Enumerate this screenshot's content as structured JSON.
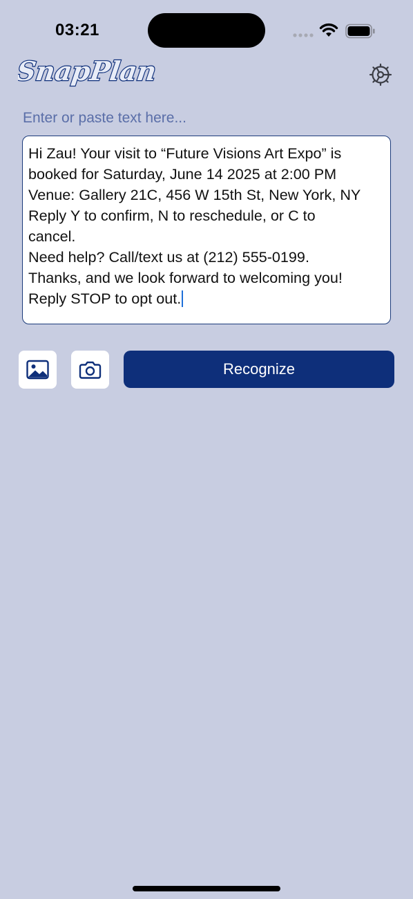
{
  "status_bar": {
    "time": "03:21"
  },
  "header": {
    "app_name": "SnapPlan",
    "settings_icon": "gear-icon"
  },
  "input": {
    "placeholder": "Enter or paste text here...",
    "lines": [
      "Hi Zau! Your visit to “Future Visions Art Expo” is",
      "booked for Saturday, June 14 2025 at 2:00 PM",
      "Venue: Gallery 21C, 456 W 15th St, New York, NY",
      "Reply Y to confirm, N to reschedule, or C to",
      "cancel.",
      "Need help? Call/text us at (212) 555-0199.",
      "Thanks, and we look forward to welcoming you!",
      "Reply STOP to opt out."
    ]
  },
  "actions": {
    "photo_icon": "photo-library-icon",
    "camera_icon": "camera-icon",
    "recognize_label": "Recognize"
  },
  "colors": {
    "background": "#c8cde1",
    "accent": "#0e2f7a",
    "placeholder": "#5a6ea8"
  }
}
